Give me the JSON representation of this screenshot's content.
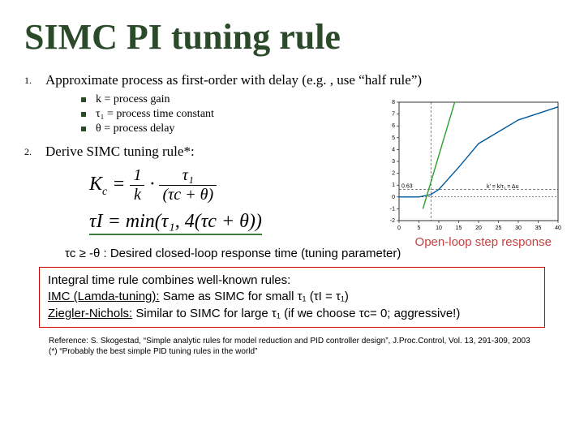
{
  "title": "SIMC PI tuning rule",
  "list": {
    "item1_num": "1.",
    "item1": "Approximate process as first-order with delay (e.g. , use “half rule”)",
    "sub1": "k = process gain",
    "sub2": "τ₁ = process time constant",
    "sub3": "θ = process delay",
    "item2_num": "2.",
    "item2": "Derive SIMC tuning rule*:"
  },
  "equations": {
    "kc_left": "K",
    "kc_sub": "c",
    "kc_eq": " = ",
    "kc_f1_top": "1",
    "kc_f1_bot": "k",
    "kc_dot": " · ",
    "kc_f2_top": "τ₁",
    "kc_f2_bot": "(τc + θ)",
    "ti": "τI = min(τ₁, 4(τc + θ))"
  },
  "param_line": "τc ≥ -θ : Desired closed-loop response time (tuning parameter)",
  "chart_caption": "Open-loop step response",
  "box": {
    "line1": "Integral time rule combines well-known rules:",
    "line2a": "IMC (Lamda-tuning):",
    "line2b": " Same as SIMC for small τ₁ (τI = τ₁)",
    "line3a": "Ziegler-Nichols:",
    "line3b": " Similar to SIMC for large τ₁ (if we choose τc= 0; aggressive!)"
  },
  "refs": {
    "r1": "Reference: S. Skogestad, “Simple analytic rules for model reduction and PID controller design”, J.Proc.Control, Vol. 13, 291-309, 2003",
    "r2": "(*) “Probably the best simple PID tuning rules in the world”"
  },
  "chart_data": {
    "type": "line",
    "title": "",
    "xlabel": "",
    "ylabel": "",
    "xlim": [
      0,
      40
    ],
    "ylim": [
      -2,
      8
    ],
    "xticks": [
      0,
      5,
      10,
      15,
      20,
      25,
      30,
      35,
      40
    ],
    "yticks": [
      -2,
      -1,
      0,
      1,
      2,
      3,
      4,
      5,
      6,
      7,
      8
    ],
    "annotations": [
      "0.63",
      "k’ = k/τ₁ = Δu"
    ],
    "series": [
      {
        "name": "step-response-curve",
        "x": [
          0,
          5,
          8,
          10,
          15,
          20,
          30,
          40
        ],
        "y": [
          0,
          0,
          0.2,
          0.63,
          2.5,
          4.5,
          6.5,
          7.6
        ],
        "color": "#005a9e"
      },
      {
        "name": "tangent-line",
        "x": [
          6,
          14
        ],
        "y": [
          -1,
          8
        ],
        "color": "#2aa02a"
      }
    ],
    "hlines": [
      {
        "y": 0.63,
        "style": "dashed"
      }
    ],
    "vlines": [
      {
        "x": 8,
        "style": "dashed"
      }
    ]
  }
}
